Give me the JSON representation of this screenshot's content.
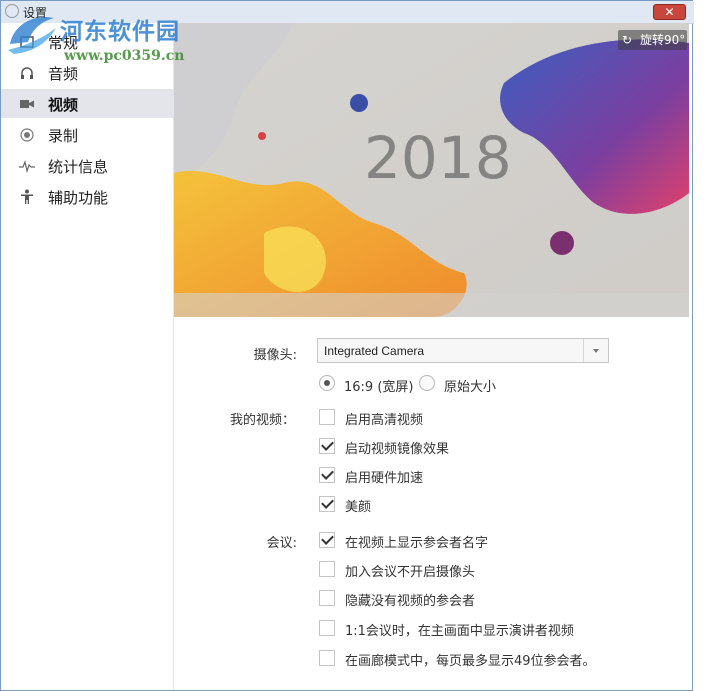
{
  "window": {
    "title": "设置",
    "close_icon": "close-icon",
    "close_label": "✕"
  },
  "watermark": {
    "name": "河东软件园",
    "url": "www.pc0359.cn"
  },
  "sidebar": {
    "items": [
      {
        "label": "常规",
        "icon": "general-icon",
        "active": false
      },
      {
        "label": "音频",
        "icon": "headphone-icon",
        "active": false
      },
      {
        "label": "视频",
        "icon": "camera-icon",
        "active": true
      },
      {
        "label": "录制",
        "icon": "record-icon",
        "active": false
      },
      {
        "label": "统计信息",
        "icon": "stats-icon",
        "active": false
      },
      {
        "label": "辅助功能",
        "icon": "accessibility-icon",
        "active": false
      }
    ]
  },
  "preview": {
    "rotate_label": "旋转90°",
    "rotate_icon": "rotate-icon",
    "image_text": "2018"
  },
  "camera": {
    "label": "摄像头:",
    "selected": "Integrated Camera"
  },
  "ratio": {
    "options": [
      {
        "label": "16:9 (宽屏)",
        "checked": true
      },
      {
        "label": "原始大小",
        "checked": false
      }
    ]
  },
  "my_video": {
    "label": "我的视频：",
    "options": [
      {
        "label": "启用高清视频",
        "checked": false
      },
      {
        "label": "启动视频镜像效果",
        "checked": true
      },
      {
        "label": "启用硬件加速",
        "checked": true
      },
      {
        "label": "美颜",
        "checked": true
      }
    ]
  },
  "meeting": {
    "label": "会议:",
    "options": [
      {
        "label": "在视频上显示参会者名字",
        "checked": true
      },
      {
        "label": "加入会议不开启摄像头",
        "checked": false
      },
      {
        "label": "隐藏没有视频的参会者",
        "checked": false
      },
      {
        "label": "1:1会议时，在主画面中显示演讲者视频",
        "checked": false
      },
      {
        "label": "在画廊模式中，每页最多显示49位参会者。",
        "checked": false
      }
    ]
  },
  "colors": {
    "accent": "#4a90d9",
    "active_bg": "#e3e5ea",
    "close": "#c9463d"
  }
}
